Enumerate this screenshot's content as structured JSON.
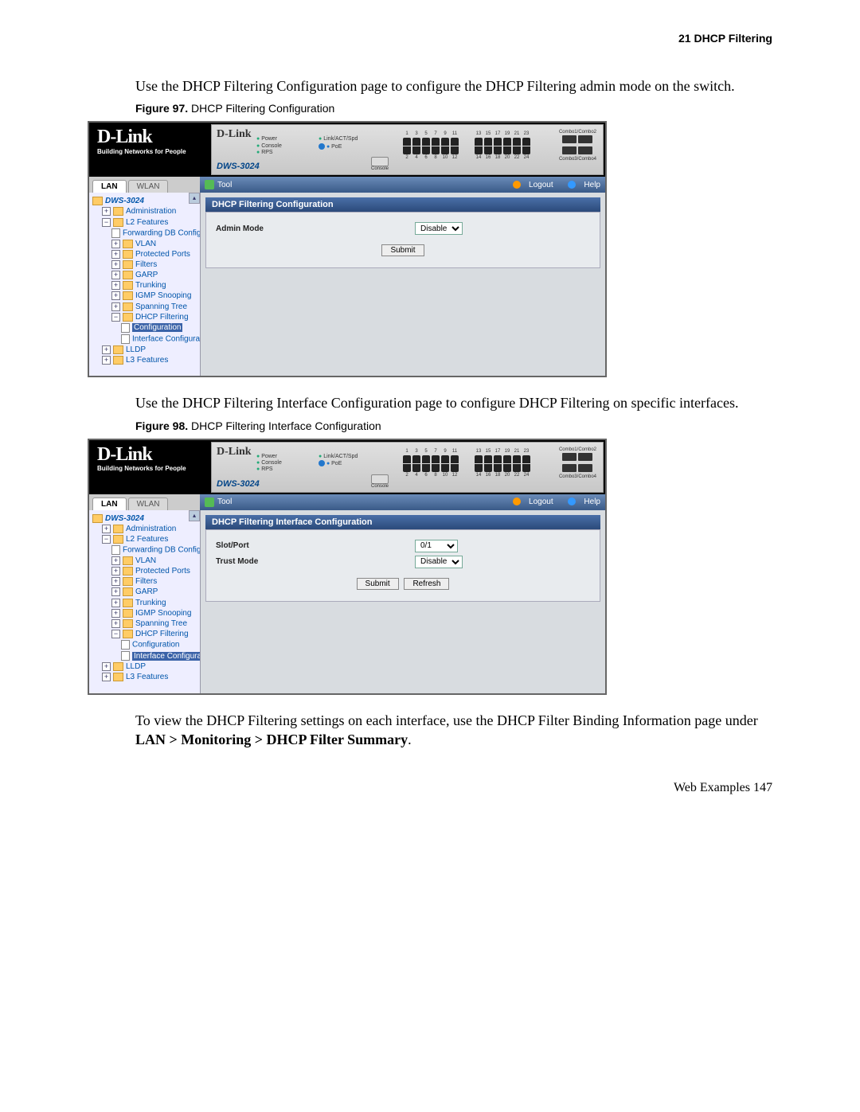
{
  "page_header": "21    DHCP Filtering",
  "para1": "Use the DHCP Filtering Configuration page to configure the DHCP Filtering admin mode on the switch.",
  "fig97_label": "Figure 97. ",
  "fig97_title": "DHCP Filtering Configuration",
  "para2": "Use the DHCP Filtering Interface Configuration page to configure DHCP Filtering on specific interfaces.",
  "fig98_label": "Figure 98. ",
  "fig98_title": "DHCP Filtering Interface Configuration",
  "para3_a": "To view the DHCP Filtering settings on each interface, use the DHCP Filter Binding Information page under ",
  "para3_b": "LAN > Monitoring > DHCP Filter Summary",
  "para3_c": ".",
  "footer": "Web Examples      147",
  "device": {
    "brand": "D-Link",
    "tagline": "Building Networks for People",
    "model": "DWS-3024",
    "leds": {
      "power": "Power",
      "console": "Console",
      "rps": "RPS",
      "link": "Link/ACT/Spd",
      "poe": "PoE"
    },
    "console_label": "Console",
    "combo1": "Combo1/Combo2",
    "combo2": "Combo3/Combo4",
    "ports_top": [
      "1",
      "3",
      "5",
      "7",
      "9",
      "11"
    ],
    "ports_bot": [
      "2",
      "4",
      "6",
      "8",
      "10",
      "12"
    ],
    "ports2_top": [
      "13",
      "15",
      "17",
      "19",
      "21",
      "23"
    ],
    "ports2_bot": [
      "14",
      "16",
      "18",
      "20",
      "22",
      "24"
    ]
  },
  "tabs": {
    "lan": "LAN",
    "wlan": "WLAN"
  },
  "toolbar": {
    "tool": "Tool",
    "logout": "Logout",
    "help": "Help"
  },
  "tree": {
    "root": "DWS-3024",
    "admin": "Administration",
    "l2": "L2 Features",
    "fdb": "Forwarding DB Configu",
    "vlan": "VLAN",
    "pports": "Protected Ports",
    "filters": "Filters",
    "garp": "GARP",
    "trunking": "Trunking",
    "igmp": "IGMP Snooping",
    "stp": "Spanning Tree",
    "dhcp": "DHCP Filtering",
    "config": "Configuration",
    "iface": "Interface Configurat",
    "lldp": "LLDP",
    "l3": "L3 Features"
  },
  "fig97": {
    "panel_title": "DHCP Filtering Configuration",
    "admin_mode_label": "Admin Mode",
    "admin_mode_value": "Disable",
    "submit": "Submit"
  },
  "fig98": {
    "panel_title": "DHCP Filtering Interface Configuration",
    "slot_label": "Slot/Port",
    "slot_value": "0/1",
    "trust_label": "Trust Mode",
    "trust_value": "Disable",
    "submit": "Submit",
    "refresh": "Refresh"
  }
}
